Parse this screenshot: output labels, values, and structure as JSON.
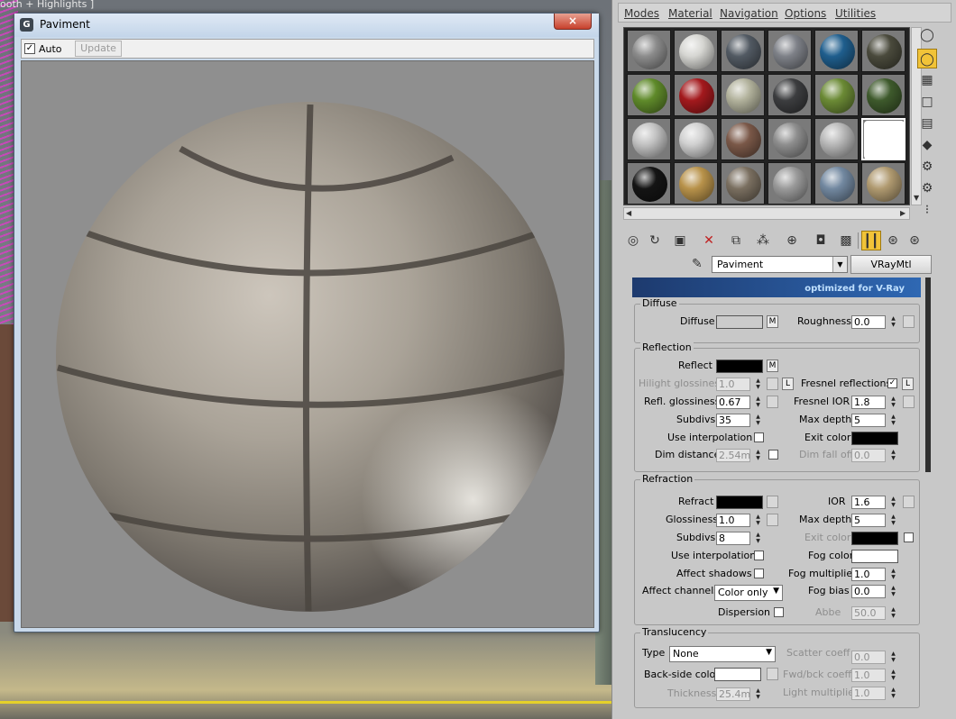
{
  "viewport_label": "ooth + Highlights ]",
  "render_window": {
    "title": "Paviment",
    "close_icon": "×",
    "auto_label": "Auto",
    "auto_checked": "✓",
    "update_label": "Update"
  },
  "material_editor": {
    "menu": [
      "Modes",
      "Material",
      "Navigation",
      "Options",
      "Utilities"
    ],
    "material_name": "Paviment",
    "material_type": "VRayMtl",
    "banner_text": "optimized for V-Ray",
    "slot_colors": [
      [
        "#8c8c8c",
        "#d6d6d2",
        "#525a63",
        "#7e8188",
        "#1f5e8d",
        "#4a4a3c"
      ],
      [
        "#5f8a2a",
        "#a3191d",
        "#b2b29c",
        "#3c3d3f",
        "#6b8a35",
        "#3e5a2c"
      ],
      [
        "#c2c2c2",
        "#d0d0d0",
        "#7a5848",
        "#8e8e8e",
        "#b8b8b8",
        "#ffffff"
      ],
      [
        "#141414",
        "#b8924a",
        "#7a6f60",
        "#9a9a9a",
        "#7288a0",
        "#b09a70"
      ]
    ],
    "diffuse": {
      "title": "Diffuse",
      "diffuse_label": "Diffuse",
      "m_label": "M",
      "roughness_label": "Roughness",
      "roughness_value": "0.0"
    },
    "reflection": {
      "title": "Reflection",
      "reflect_label": "Reflect",
      "m_label": "M",
      "hilight_label": "Hilight glossiness",
      "hilight_value": "1.0",
      "l_label": "L",
      "fresnel_label": "Fresnel reflections",
      "fresnel_checked": "✓",
      "fresnel_l": "L",
      "refl_gloss_label": "Refl. glossiness",
      "refl_gloss_value": "0.67",
      "fresnel_ior_label": "Fresnel IOR",
      "fresnel_ior_value": "1.8",
      "subdivs_label": "Subdivs",
      "subdivs_value": "35",
      "max_depth_label": "Max depth",
      "max_depth_value": "5",
      "use_interp_label": "Use interpolation",
      "exit_color_label": "Exit color",
      "dim_distance_label": "Dim distance",
      "dim_distance_value": "2.54m",
      "dim_falloff_label": "Dim fall off",
      "dim_falloff_value": "0.0"
    },
    "refraction": {
      "title": "Refraction",
      "refract_label": "Refract",
      "ior_label": "IOR",
      "ior_value": "1.6",
      "glossiness_label": "Glossiness",
      "glossiness_value": "1.0",
      "max_depth_label": "Max depth",
      "max_depth_value": "5",
      "subdivs_label": "Subdivs",
      "subdivs_value": "8",
      "exit_color_label": "Exit color",
      "use_interp_label": "Use interpolation",
      "fog_color_label": "Fog color",
      "affect_shadows_label": "Affect shadows",
      "fog_mult_label": "Fog multiplier",
      "fog_mult_value": "1.0",
      "affect_channels_label": "Affect channels",
      "affect_channels_value": "Color only",
      "fog_bias_label": "Fog bias",
      "fog_bias_value": "0.0",
      "dispersion_label": "Dispersion",
      "abbe_label": "Abbe",
      "abbe_value": "50.0"
    },
    "translucency": {
      "title": "Translucency",
      "type_label": "Type",
      "type_value": "None",
      "scatter_label": "Scatter coeff",
      "scatter_value": "0.0",
      "backside_label": "Back-side color",
      "fwd_bck_label": "Fwd/bck coeff",
      "fwd_bck_value": "1.0",
      "thickness_label": "Thickness",
      "thickness_value": "25.4m",
      "light_mult_label": "Light multiplier",
      "light_mult_value": "1.0"
    }
  }
}
